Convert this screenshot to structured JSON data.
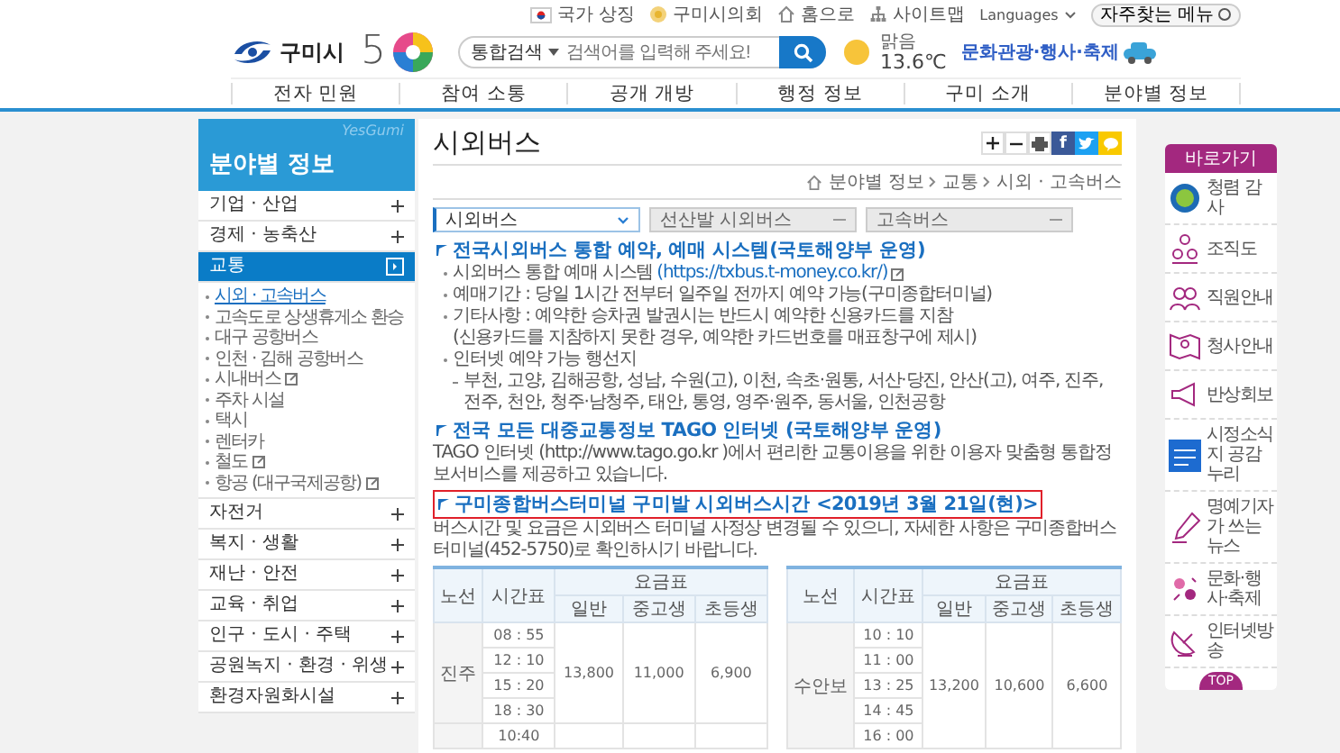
{
  "utility_links": [
    {
      "label": "국가 상징",
      "kind": "flag"
    },
    {
      "label": "구미시의회",
      "kind": "emblem"
    },
    {
      "label": "홈으로",
      "kind": "home"
    },
    {
      "label": "사이트맵",
      "kind": "sitemap"
    }
  ],
  "languages": {
    "label": "Languages"
  },
  "favorites_button": {
    "label": "자주찾는 메뉴"
  },
  "logo": {
    "name": "구미시",
    "anniversary_digit": "5"
  },
  "search": {
    "scope": "통합검색",
    "placeholder": "검색어를 입력해 주세요!"
  },
  "weather": {
    "condition": "맑음",
    "temperature": "13.6℃"
  },
  "festival_banner": {
    "label": "문화관광·행사·축제"
  },
  "nav": [
    "전자 민원",
    "참여 소통",
    "공개 개방",
    "행정 정보",
    "구미 소개",
    "분야별 정보"
  ],
  "sidebar": {
    "brand": "YesGumi",
    "title": "분야별 정보",
    "items": [
      {
        "label": "기업 · 산업",
        "expanded": false
      },
      {
        "label": "경제 · 농축산",
        "expanded": false
      },
      {
        "label": "교통",
        "expanded": true,
        "children": [
          {
            "label": "시외 · 고속버스",
            "selected": true,
            "external": false
          },
          {
            "label": "고속도로 상생휴게소 환승",
            "selected": false,
            "external": false
          },
          {
            "label": "대구 공항버스",
            "selected": false,
            "external": false
          },
          {
            "label": "인천 · 김해 공항버스",
            "selected": false,
            "external": false
          },
          {
            "label": "시내버스",
            "selected": false,
            "external": true
          },
          {
            "label": "주차 시설",
            "selected": false,
            "external": false
          },
          {
            "label": "택시",
            "selected": false,
            "external": false
          },
          {
            "label": "렌터카",
            "selected": false,
            "external": false
          },
          {
            "label": "철도",
            "selected": false,
            "external": true
          },
          {
            "label": "항공 (대구국제공항)",
            "selected": false,
            "external": true
          }
        ]
      },
      {
        "label": "자전거",
        "expanded": false
      },
      {
        "label": "복지 · 생활",
        "expanded": false
      },
      {
        "label": "재난 · 안전",
        "expanded": false
      },
      {
        "label": "교육 · 취업",
        "expanded": false
      },
      {
        "label": "인구 · 도시 · 주택",
        "expanded": false
      },
      {
        "label": "공원녹지 · 환경 · 위생",
        "expanded": false
      },
      {
        "label": "환경자원화시설",
        "expanded": false
      }
    ]
  },
  "main": {
    "title": "시외버스",
    "tools": [
      {
        "kind": "zoom_in"
      },
      {
        "kind": "zoom_out"
      },
      {
        "kind": "print"
      },
      {
        "kind": "facebook",
        "label": "f"
      },
      {
        "kind": "twitter"
      },
      {
        "kind": "kakao"
      }
    ],
    "breadcrumb": [
      "분야별 정보",
      "교통",
      "시외 · 고속버스"
    ],
    "tabs": [
      {
        "label": "시외버스",
        "selected": true
      },
      {
        "label": "선산발 시외버스",
        "selected": false
      },
      {
        "label": "고속버스",
        "selected": false
      }
    ],
    "sections": [
      {
        "heading": "전국시외버스 통합 예약, 예매 시스템(국토해양부 운영)",
        "highlighted": false,
        "bullets": [
          {
            "text": "시외버스 통합 예매 시스템",
            "link": "(https://txbus.t-money.co.kr/)",
            "external": true
          },
          {
            "text": "예매기간 : 당일 1시간 전부터 일주일 전까지 예약 가능(구미종합터미널)"
          },
          {
            "text": "기타사항 : 예약한 승차권 발권시는 반드시 예약한 신용카드를 지참",
            "continuation": "(신용카드를 지참하지 못한 경우, 예약한 카드번호를 매표창구에 제시)"
          },
          {
            "text": "인터넷 예약 가능 행선지",
            "sub": [
              "부천, 고양, 김해공항, 성남, 수원(고), 이천, 속초·원통, 서산·당진, 안산(고), 여주, 진주, 전주, 천안, 청주·남청주, 태안, 통영, 영주·원주, 동서울, 인천공항"
            ]
          }
        ]
      },
      {
        "heading": "전국 모든 대중교통정보 TAGO 인터넷 (국토해양부 운영)",
        "highlighted": false,
        "paragraph": "TAGO 인터넷 (http://www.tago.go.kr )에서 편리한 교통이용을 위한 이용자 맞춤형 통합정보서비스를 제공하고 있습니다."
      },
      {
        "heading": "구미종합버스터미널 구미발 시외버스시간 <2019년 3월 21일(현)>",
        "highlighted": true,
        "paragraph": "버스시간 및 요금은 시외버스 터미널 사정상 변경될 수 있으니, 자세한 사항은 구미종합버스터미널(452-5750)로 확인하시기 바랍니다.",
        "tables": [
          {
            "columns": {
              "route": "노선",
              "times": "시간표",
              "fares": "요금표",
              "fare_types": [
                "일반",
                "중고생",
                "초등생"
              ]
            },
            "groups": [
              {
                "route": "진주",
                "times": [
                  "08 : 55",
                  "12 : 10",
                  "15 : 20",
                  "18 : 30"
                ],
                "fares": [
                  "13,800",
                  "11,000",
                  "6,900"
                ]
              },
              {
                "times": [
                  "10:40"
                ]
              }
            ]
          },
          {
            "columns": {
              "route": "노선",
              "times": "시간표",
              "fares": "요금표",
              "fare_types": [
                "일반",
                "중고생",
                "초등생"
              ]
            },
            "groups": [
              {
                "route": "수안보",
                "times": [
                  "10 : 10",
                  "11 : 00",
                  "13 : 25",
                  "14 : 45",
                  "16 : 00"
                ],
                "fares": [
                  "13,200",
                  "10,600",
                  "6,600"
                ]
              }
            ]
          }
        ]
      }
    ]
  },
  "quick_links": {
    "title": "바로가기",
    "items": [
      {
        "label": "청렴 감사",
        "kind": "badge"
      },
      {
        "label": "조직도",
        "kind": "org"
      },
      {
        "label": "직원안내",
        "kind": "people"
      },
      {
        "label": "청사안내",
        "kind": "map"
      },
      {
        "label": "반상회보",
        "kind": "megaphone"
      },
      {
        "label": "시정소식지 공감누리",
        "kind": "newsletter"
      },
      {
        "label": "명예기자가 쓰는 뉴스",
        "kind": "pen"
      },
      {
        "label": "문화·행사·축제",
        "kind": "festival"
      },
      {
        "label": "인터넷방송",
        "kind": "dish"
      }
    ],
    "top_button": "TOP"
  }
}
